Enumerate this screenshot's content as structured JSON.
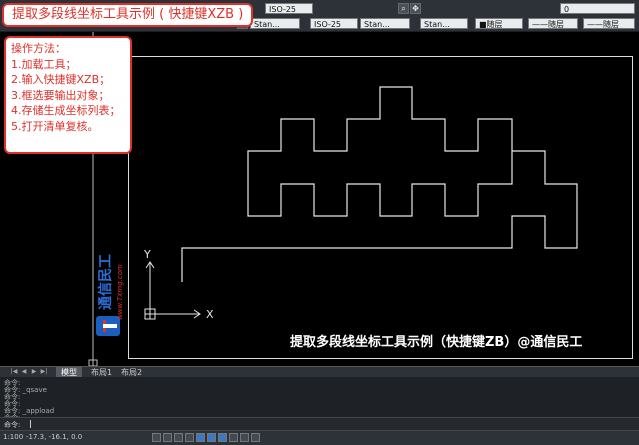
{
  "title_tag": "提取多段线坐标工具示例 ( 快捷键XZB )",
  "instructions": {
    "heading": "操作方法：",
    "steps": [
      "1.加载工具；",
      "2.输入快捷键XZB；",
      "3.框选要输出对象；",
      "4.存储生成坐标列表；",
      "5.打开清单复核。"
    ]
  },
  "toolbar": {
    "text_style": "Stan...",
    "dim_style": "ISO-25",
    "dim_style_2": "ISO-25",
    "table_style": "Stan...",
    "multileader_style": "Stan...",
    "layer": "0",
    "color": "■随层",
    "linetype": "——随层",
    "lineweight": "——随层"
  },
  "canvas": {
    "axis_y": "Y",
    "axis_x": "X",
    "caption": "提取多段线坐标工具示例（快捷键ZB）@通信民工",
    "logo_text": "通信民工",
    "logo_url": "www.Txmg.com"
  },
  "tabs": [
    "模型",
    "布局1",
    "布局2"
  ],
  "command": {
    "lines": [
      "命令:",
      "命令:  _qsave",
      "命令:",
      "命令:",
      "命令:  _appload",
      "命令:"
    ],
    "prompt": "命令:"
  },
  "status": {
    "scale": "1:100",
    "coords": "-17.3, -16.1, 0.0"
  },
  "colors": {
    "accent": "#e0302a",
    "logo": "#1a5fbf"
  }
}
